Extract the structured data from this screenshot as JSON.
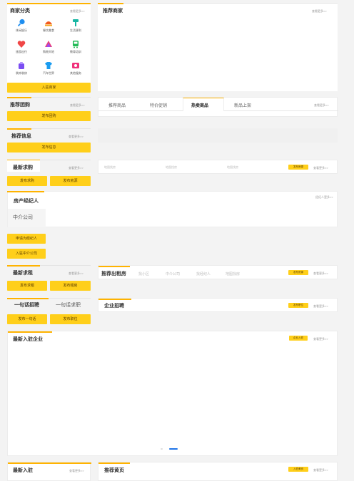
{
  "merchant_category": {
    "title": "商家分类",
    "more": "查看更多>>",
    "items": [
      {
        "label": "休闲娱乐",
        "icon": "tennis-icon",
        "color": "#1e8ef0"
      },
      {
        "label": "餐饮美食",
        "icon": "food-icon",
        "color": "#f25a1e"
      },
      {
        "label": "生活便利",
        "icon": "paint-roller-icon",
        "color": "#17b6a3"
      },
      {
        "label": "旅游出行",
        "icon": "heart-icon",
        "color": "#f04646"
      },
      {
        "label": "购物天地",
        "icon": "shopping-icon",
        "color": "#e83f7a"
      },
      {
        "label": "教育培训",
        "icon": "education-icon",
        "color": "#1fba54"
      },
      {
        "label": "装饰装修",
        "icon": "decor-icon",
        "color": "#7b4df2"
      },
      {
        "label": "汽车世界",
        "icon": "tshirt-icon",
        "color": "#1b9cf0"
      },
      {
        "label": "其他服务",
        "icon": "gift-icon",
        "color": "#f0307a"
      }
    ],
    "join_button": "入驻商家"
  },
  "recommend_merchant": {
    "title": "推荐商家",
    "more": "查看更多>>"
  },
  "group_buy": {
    "title": "推荐团购",
    "more": "查看更多>>",
    "button": "发布团购"
  },
  "product_tabs": {
    "tabs": [
      "推荐商品",
      "特价促销",
      "热卖商品",
      "新品上架"
    ],
    "active_index": 2,
    "more": "查看更多>>"
  },
  "recommend_info": {
    "title": "推荐信息",
    "more": "查看更多>>",
    "button": "发布信息"
  },
  "latest_purchase": {
    "title": "最新求购",
    "more": "查看更多>>",
    "buttons": [
      "发布求购",
      "发布房源"
    ]
  },
  "house_search": {
    "links": [
      "地图找房",
      "地图找房",
      "地图找房"
    ],
    "button": "发布房源",
    "more": "查看更多>>"
  },
  "agent": {
    "title": "房产经纪人",
    "more": "经纪人更多>>",
    "company": "中介公司",
    "buttons": [
      "申请为经纪人",
      "入驻中介公司"
    ]
  },
  "latest_rent": {
    "title": "最新求租",
    "more": "查看更多>>",
    "buttons": [
      "发布求租",
      "发布租房"
    ]
  },
  "rent_out": {
    "title": "推荐出租房",
    "links": [
      "找小区",
      "中介公司",
      "找经纪人",
      "地图找房"
    ],
    "button": "发布房源",
    "more": "查看更多>>"
  },
  "recruit": {
    "tabs": [
      "一句话招聘",
      "一句话求职"
    ],
    "buttons": [
      "发布一句话",
      "发布职位"
    ]
  },
  "enterprise_recruit": {
    "title": "企业招聘",
    "button": "发布职位",
    "more": "查看更多>>"
  },
  "new_enterprise": {
    "title": "最新入驻企业",
    "button": "企业入驻",
    "more": "查看更多>>"
  },
  "latest_join": {
    "title": "最新入驻",
    "more": "查看更多>>"
  },
  "yellow_pages": {
    "title": "推荐黄页",
    "button": "入驻黄页",
    "more": "查看更多>>"
  },
  "colors": {
    "accent": "#ffcf1a",
    "carousel_active": "#1f74e8"
  }
}
